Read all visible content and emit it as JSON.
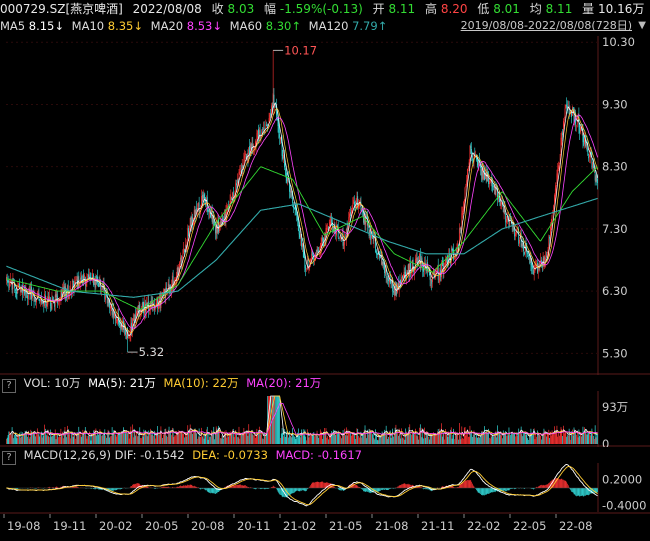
{
  "header": {
    "code_name": "000729.SZ[燕京啤酒]",
    "date": "2022/08/08",
    "close_label": "收",
    "close": "8.03",
    "change_label": "幅",
    "change": "-1.59%(-0.13)",
    "open_label": "开",
    "open": "8.11",
    "high_label": "高",
    "high": "8.20",
    "low_label": "低",
    "low": "8.01",
    "avg_label": "均",
    "avg": "8.11",
    "vol_label": "量",
    "vol": "10.16万",
    "turnover_label": "换"
  },
  "ma_row": {
    "ma5_label": "MA5",
    "ma5": "8.15↓",
    "ma10_label": "MA10",
    "ma10": "8.35↓",
    "ma20_label": "MA20",
    "ma20": "8.53↓",
    "ma60_label": "MA60",
    "ma60": "8.30↑",
    "ma120_label": "MA120",
    "ma120": "7.79↑",
    "range": "2019/08/08-2022/08/08(728日)"
  },
  "vol_header": {
    "q": "?",
    "title": "VOL: 10万",
    "ma5": "MA(5): 21万",
    "ma10": "MA(10): 22万",
    "ma20": "MA(20): 21万"
  },
  "macd_header": {
    "q": "?",
    "title": "MACD(12,26,9) DIF: -0.1542",
    "dea": "DEA: -0.0733",
    "macd": "MACD: -0.1617"
  },
  "colors": {
    "up": "#ff3333",
    "down": "#33dddd",
    "ma5": "#ffffff",
    "ma10": "#ffcc33",
    "ma20": "#ff44ff",
    "ma60": "#33dd33",
    "ma120": "#33aaaa",
    "dea": "#ffcc33",
    "dif": "#ffffff",
    "axis_text": "#cccccc"
  },
  "chart_data": [
    {
      "type": "candlestick",
      "name": "price",
      "ylim": [
        5.0,
        10.4
      ],
      "y_ticks": [
        "10.30",
        "9.30",
        "8.30",
        "7.30",
        "6.30",
        "5.30"
      ],
      "y_tick_values": [
        10.3,
        9.3,
        8.3,
        7.3,
        6.3,
        5.3
      ],
      "x_ticks": [
        "19-08",
        "19-11",
        "20-02",
        "20-05",
        "20-08",
        "20-11",
        "21-02",
        "21-05",
        "21-08",
        "21-11",
        "22-02",
        "22-05",
        "22-08"
      ],
      "annotations": [
        {
          "label": "10.17",
          "value": 10.17,
          "kind": "high"
        },
        {
          "label": "5.32",
          "value": 5.32,
          "kind": "low"
        }
      ],
      "close_trend": [
        {
          "t": 0.0,
          "v": 6.45
        },
        {
          "t": 0.04,
          "v": 6.25
        },
        {
          "t": 0.07,
          "v": 6.1
        },
        {
          "t": 0.1,
          "v": 6.35
        },
        {
          "t": 0.13,
          "v": 6.55
        },
        {
          "t": 0.15,
          "v": 6.35
        },
        {
          "t": 0.17,
          "v": 5.95
        },
        {
          "t": 0.19,
          "v": 5.6
        },
        {
          "t": 0.21,
          "v": 6.0
        },
        {
          "t": 0.24,
          "v": 6.1
        },
        {
          "t": 0.27,
          "v": 6.6
        },
        {
          "t": 0.29,
          "v": 7.4
        },
        {
          "t": 0.31,
          "v": 7.8
        },
        {
          "t": 0.33,
          "v": 7.3
        },
        {
          "t": 0.35,
          "v": 7.6
        },
        {
          "t": 0.37,
          "v": 8.3
        },
        {
          "t": 0.39,
          "v": 8.7
        },
        {
          "t": 0.41,
          "v": 9.0
        },
        {
          "t": 0.42,
          "v": 9.4
        },
        {
          "t": 0.44,
          "v": 8.2
        },
        {
          "t": 0.46,
          "v": 7.3
        },
        {
          "t": 0.47,
          "v": 6.7
        },
        {
          "t": 0.49,
          "v": 6.9
        },
        {
          "t": 0.51,
          "v": 7.4
        },
        {
          "t": 0.53,
          "v": 7.1
        },
        {
          "t": 0.55,
          "v": 7.8
        },
        {
          "t": 0.57,
          "v": 7.3
        },
        {
          "t": 0.59,
          "v": 6.8
        },
        {
          "t": 0.61,
          "v": 6.3
        },
        {
          "t": 0.63,
          "v": 6.6
        },
        {
          "t": 0.65,
          "v": 6.8
        },
        {
          "t": 0.67,
          "v": 6.5
        },
        {
          "t": 0.69,
          "v": 6.7
        },
        {
          "t": 0.71,
          "v": 7.0
        },
        {
          "t": 0.72,
          "v": 7.8
        },
        {
          "t": 0.73,
          "v": 8.6
        },
        {
          "t": 0.75,
          "v": 8.2
        },
        {
          "t": 0.77,
          "v": 7.9
        },
        {
          "t": 0.79,
          "v": 7.4
        },
        {
          "t": 0.81,
          "v": 7.1
        },
        {
          "t": 0.83,
          "v": 6.6
        },
        {
          "t": 0.85,
          "v": 6.8
        },
        {
          "t": 0.86,
          "v": 7.6
        },
        {
          "t": 0.88,
          "v": 9.3
        },
        {
          "t": 0.9,
          "v": 9.0
        },
        {
          "t": 0.92,
          "v": 8.4
        },
        {
          "t": 0.93,
          "v": 8.05
        }
      ],
      "ma120_trend": [
        {
          "t": 0.0,
          "v": 6.7
        },
        {
          "t": 0.1,
          "v": 6.3
        },
        {
          "t": 0.2,
          "v": 6.2
        },
        {
          "t": 0.27,
          "v": 6.3
        },
        {
          "t": 0.33,
          "v": 6.8
        },
        {
          "t": 0.4,
          "v": 7.6
        },
        {
          "t": 0.46,
          "v": 7.7
        },
        {
          "t": 0.53,
          "v": 7.4
        },
        {
          "t": 0.6,
          "v": 7.1
        },
        {
          "t": 0.66,
          "v": 6.9
        },
        {
          "t": 0.72,
          "v": 6.9
        },
        {
          "t": 0.78,
          "v": 7.3
        },
        {
          "t": 0.84,
          "v": 7.5
        },
        {
          "t": 0.93,
          "v": 7.79
        }
      ],
      "ma60_trend": [
        {
          "t": 0.0,
          "v": 6.5
        },
        {
          "t": 0.08,
          "v": 6.3
        },
        {
          "t": 0.15,
          "v": 6.3
        },
        {
          "t": 0.21,
          "v": 6.0
        },
        {
          "t": 0.27,
          "v": 6.4
        },
        {
          "t": 0.33,
          "v": 7.4
        },
        {
          "t": 0.4,
          "v": 8.3
        },
        {
          "t": 0.45,
          "v": 8.1
        },
        {
          "t": 0.5,
          "v": 7.2
        },
        {
          "t": 0.56,
          "v": 7.5
        },
        {
          "t": 0.61,
          "v": 6.9
        },
        {
          "t": 0.67,
          "v": 6.6
        },
        {
          "t": 0.72,
          "v": 7.1
        },
        {
          "t": 0.78,
          "v": 7.9
        },
        {
          "t": 0.84,
          "v": 7.1
        },
        {
          "t": 0.89,
          "v": 7.9
        },
        {
          "t": 0.93,
          "v": 8.3
        }
      ]
    },
    {
      "type": "bar",
      "name": "volume",
      "y_ticks": [
        "93万",
        "0"
      ],
      "y_tick_values": [
        93,
        0
      ],
      "ylim": [
        0,
        130
      ]
    },
    {
      "type": "macd",
      "name": "macd",
      "y_ticks": [
        "0.2000",
        "-0.4000"
      ],
      "y_tick_values": [
        0.2,
        -0.4
      ],
      "ylim": [
        -0.55,
        0.55
      ]
    }
  ]
}
